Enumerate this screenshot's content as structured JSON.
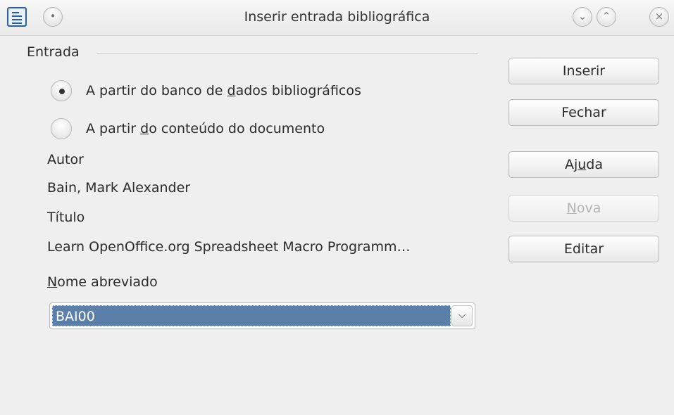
{
  "window": {
    "title": "Inserir entrada bibliográfica",
    "icons": {
      "app": "document-icon",
      "menu": "window-menu-icon",
      "minimize": "minimize-icon",
      "maximize": "maximize-icon",
      "close": "close-icon"
    }
  },
  "entry": {
    "group_label": "Entrada",
    "radio_db": {
      "pre": "A partir do banco de ",
      "accel": "d",
      "post": "ados bibliográficos",
      "checked": true
    },
    "radio_doc": {
      "pre": "A partir ",
      "accel": "d",
      "post": "o conteúdo do documento",
      "checked": false
    }
  },
  "fields": {
    "author_label": "Autor",
    "author_value": "Bain, Mark Alexander",
    "title_label": "Título",
    "title_value": "Learn OpenOffice.org Spreadsheet Macro Programm…",
    "shortname_label_accel": "N",
    "shortname_label_rest": "ome abreviado",
    "shortname_value": "BAI00"
  },
  "buttons": {
    "insert": "Inserir",
    "close": "Fechar",
    "help_pre": "Aj",
    "help_accel": "u",
    "help_post": "da",
    "new_accel": "N",
    "new_rest": "ova",
    "edit": "Editar"
  },
  "colors": {
    "selection": "#5b7fa9",
    "icon_blue": "#2c5f99"
  }
}
